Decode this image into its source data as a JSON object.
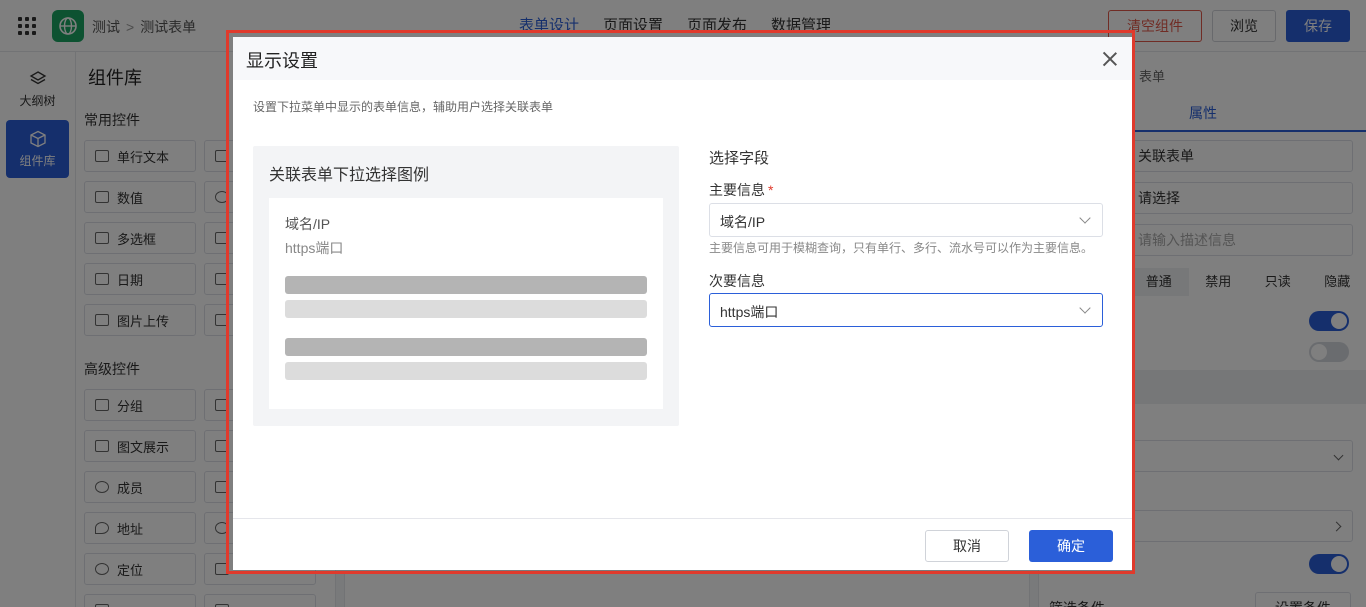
{
  "topbar": {
    "breadcrumb": [
      "测试",
      "测试表单"
    ],
    "tabs": [
      "表单设计",
      "页面设置",
      "页面发布",
      "数据管理"
    ],
    "clear_label": "清空组件",
    "browse_label": "浏览",
    "save_label": "保存"
  },
  "rail": {
    "items": [
      "大纲树",
      "组件库"
    ]
  },
  "library": {
    "title": "组件库",
    "common_section": "常用控件",
    "common": [
      "单行文本",
      "数值",
      "多选框",
      "日期",
      "图片上传"
    ],
    "advanced_section": "高级控件",
    "advanced": [
      "分组",
      "图文展示",
      "成员",
      "地址",
      "定位"
    ]
  },
  "props": {
    "crumb_tail": "表单",
    "tab": "属性",
    "form_name": "关联表单",
    "select_placeholder": "请选择",
    "desc_placeholder": "请输入描述信息",
    "states": [
      "普通",
      "禁用",
      "只读",
      "隐藏"
    ],
    "filter_label": "筛选条件",
    "filter_button": "设置条件"
  },
  "dialog": {
    "title": "显示设置",
    "description": "设置下拉菜单中显示的表单信息，辅助用户选择关联表单",
    "preview_title": "关联表单下拉选择图例",
    "preview_primary": "域名/IP",
    "preview_secondary": "https端口",
    "fields_title": "选择字段",
    "primary_label": "主要信息",
    "required_mark": "*",
    "primary_value": "域名/IP",
    "primary_hint": "主要信息可用于模糊查询，只有单行、多行、流水号可以作为主要信息。",
    "secondary_label": "次要信息",
    "secondary_value": "https端口",
    "cancel_label": "取消",
    "ok_label": "确定"
  },
  "colors": {
    "accent": "#2b5fd9",
    "danger": "#e03a2c",
    "brand": "#1aa563"
  }
}
